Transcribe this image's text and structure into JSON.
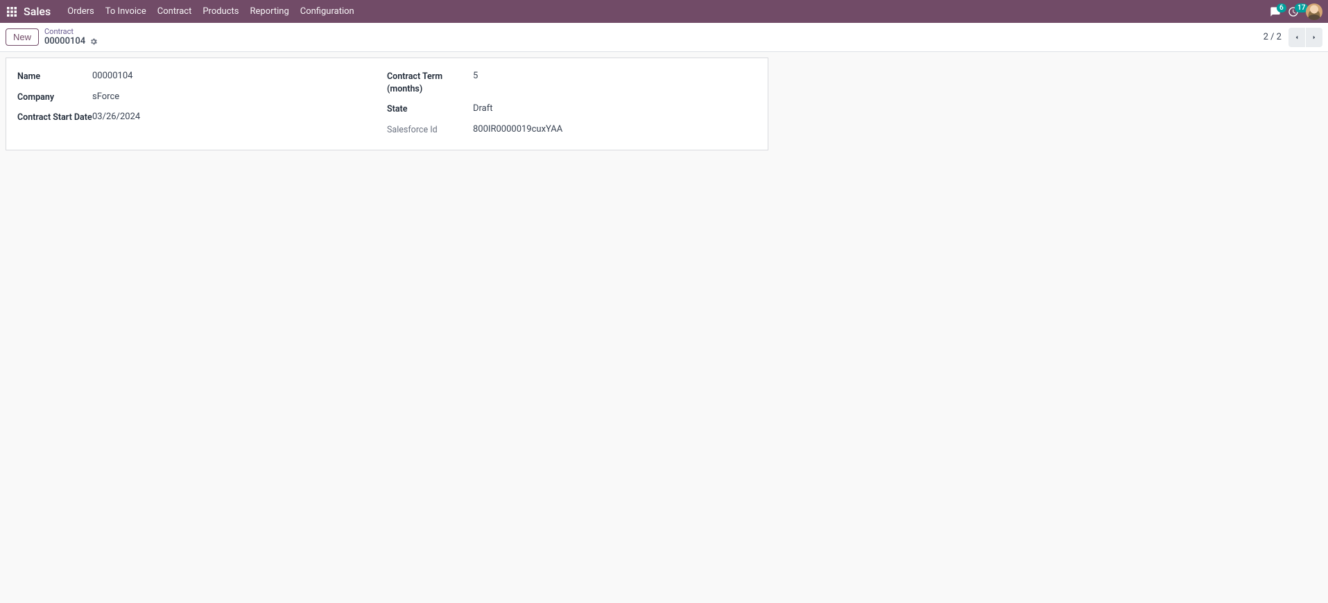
{
  "navbar": {
    "brand": "Sales",
    "menu": [
      "Orders",
      "To Invoice",
      "Contract",
      "Products",
      "Reporting",
      "Configuration"
    ],
    "messages_badge": "6",
    "activities_badge": "17"
  },
  "control": {
    "new_label": "New",
    "breadcrumb_parent": "Contract",
    "breadcrumb_current": "00000104",
    "pager": "2 / 2"
  },
  "form": {
    "left": {
      "name": {
        "label": "Name",
        "value": "00000104"
      },
      "company": {
        "label": "Company",
        "value": "sForce"
      },
      "start_date": {
        "label": "Contract Start Date",
        "value": "03/26/2024"
      }
    },
    "right": {
      "term": {
        "label": "Contract Term (months)",
        "value": "5"
      },
      "state": {
        "label": "State",
        "value": "Draft"
      },
      "sf_id": {
        "label": "Salesforce Id",
        "value": "800IR0000019cuxYAA"
      }
    }
  }
}
